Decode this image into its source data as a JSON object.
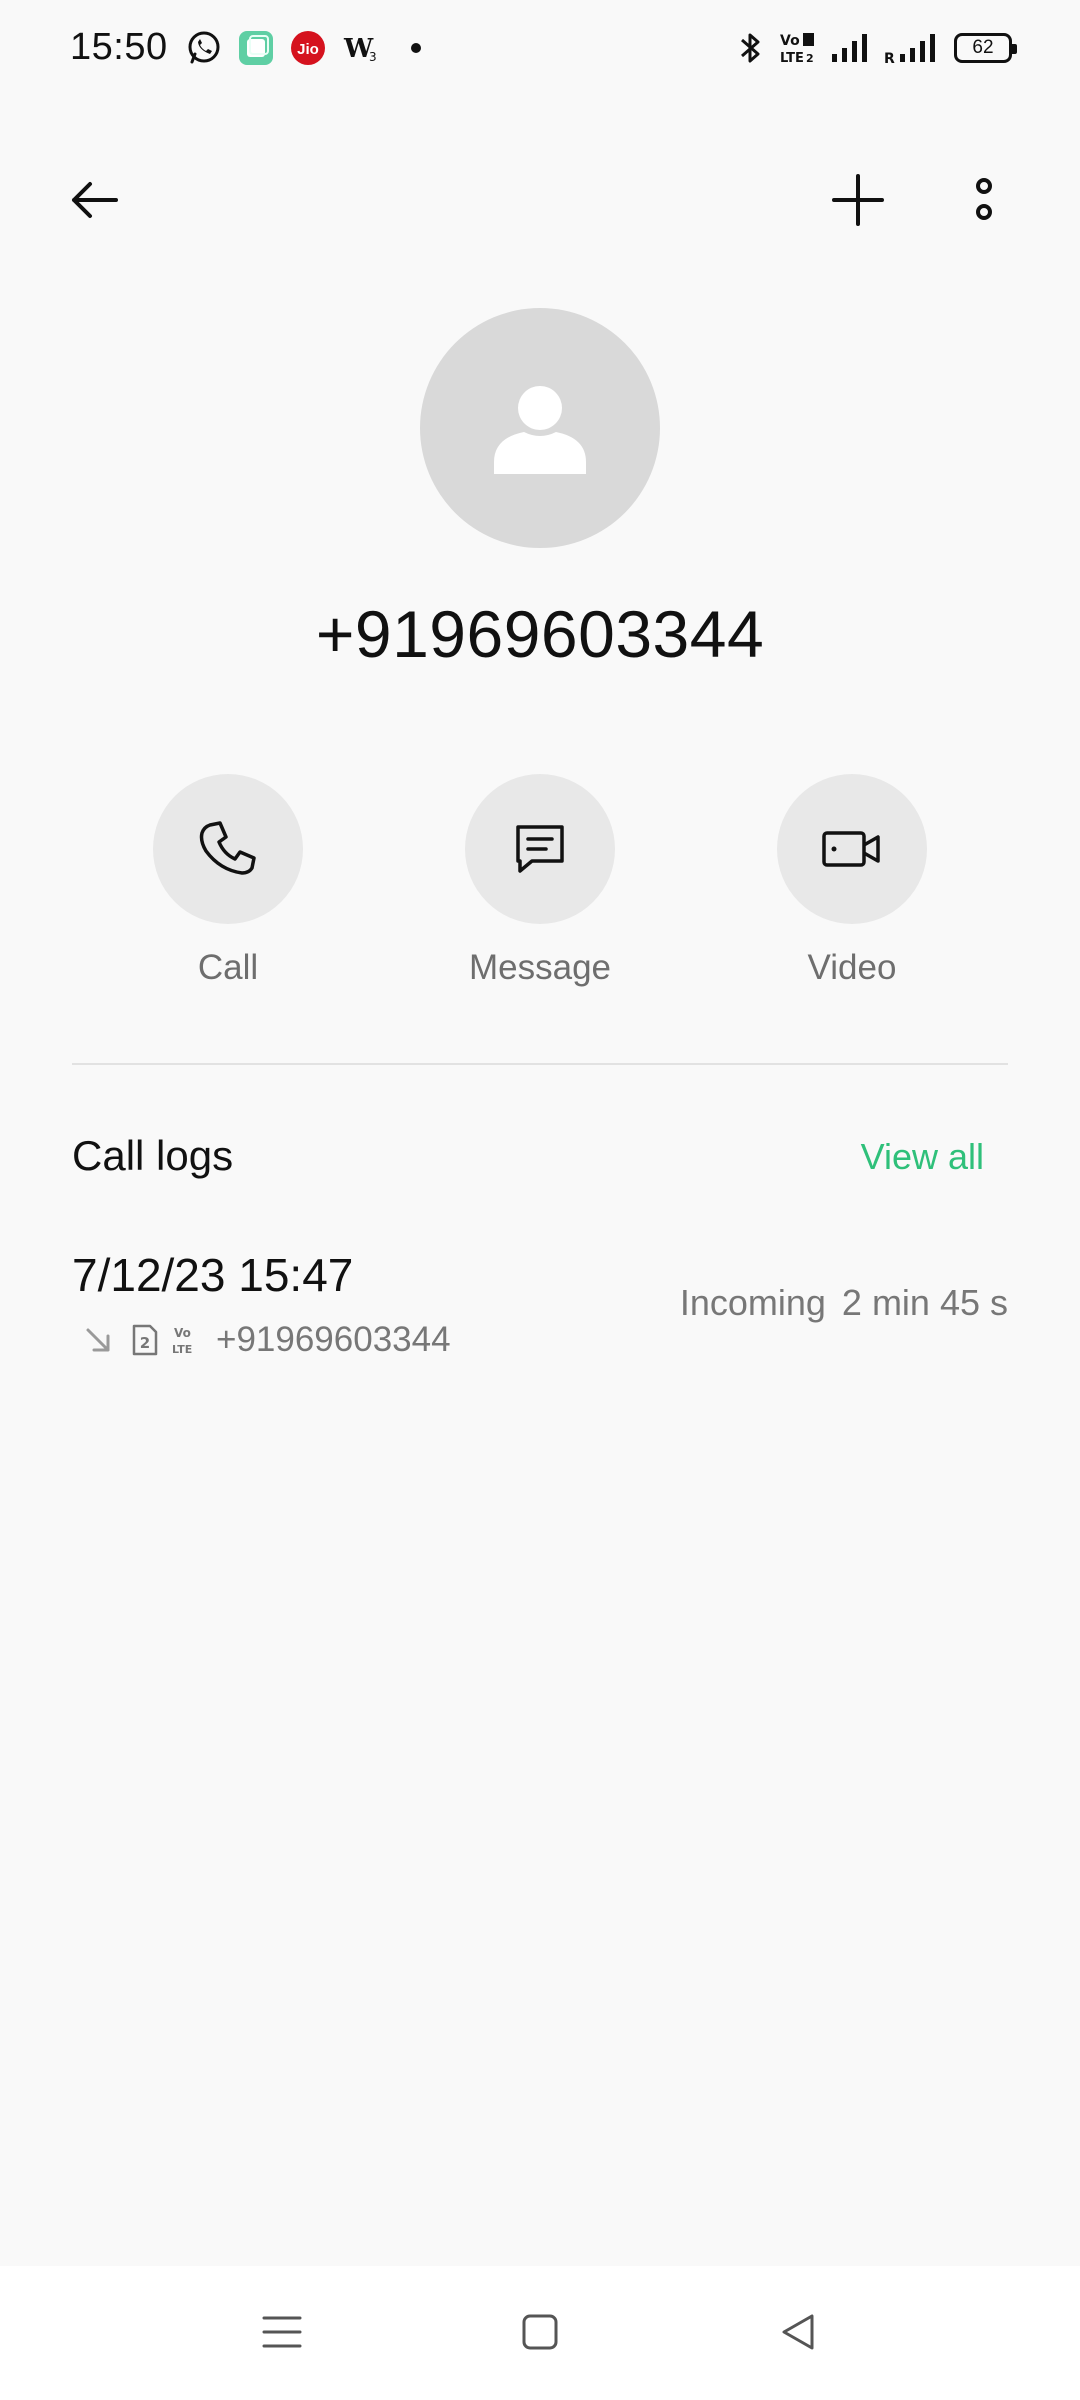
{
  "status_bar": {
    "time": "15:50",
    "battery": "62",
    "left_icons": [
      "whatsapp-icon",
      "app-clone-icon",
      "jio-icon",
      "w3-icon",
      "dot-icon"
    ],
    "right_icons": [
      "bluetooth-icon",
      "volte-icon",
      "signal-icon",
      "roaming-signal-icon",
      "battery-icon"
    ],
    "jio_label": "Jio",
    "volte_label": "VoLTE"
  },
  "app_bar": {
    "icons": [
      "back-arrow-icon",
      "plus-icon",
      "more-vertical-icon"
    ]
  },
  "contact": {
    "number": "+91969603344",
    "avatar_icon": "person-icon"
  },
  "actions": [
    {
      "label": "Call",
      "icon": "phone-icon"
    },
    {
      "label": "Message",
      "icon": "message-icon"
    },
    {
      "label": "Video",
      "icon": "video-camera-icon"
    }
  ],
  "call_logs": {
    "title": "Call logs",
    "view_all": "View all",
    "accent_color": "#2fc07a",
    "items": [
      {
        "datetime": "7/12/23 15:47",
        "number": "+91969603344",
        "direction": "Incoming",
        "duration": "2 min 45 s",
        "icons": [
          "incoming-arrow-icon",
          "sim-2-icon",
          "volte-icon"
        ]
      }
    ]
  },
  "nav_bar": {
    "icons": [
      "menu-icon",
      "home-square-icon",
      "back-triangle-icon"
    ]
  }
}
